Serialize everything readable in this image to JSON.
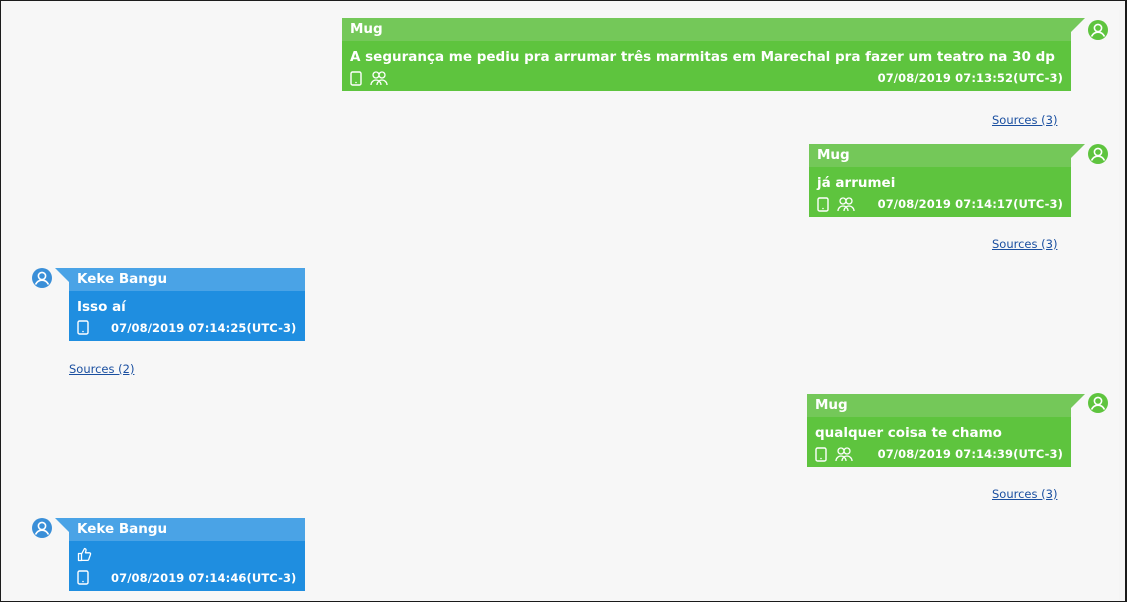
{
  "messages": [
    {
      "sender": "Mug",
      "text": "A segurança me pediu pra arrumar três marmitas em Marechal pra fazer um teatro na 30 dp",
      "timestamp": "07/08/2019 07:13:52(UTC-3)",
      "sources": "Sources (3)",
      "icons": [
        "phone-icon",
        "group-icon"
      ]
    },
    {
      "sender": "Mug",
      "text": "já arrumei",
      "timestamp": "07/08/2019 07:14:17(UTC-3)",
      "sources": "Sources (3)",
      "icons": [
        "phone-icon",
        "group-icon"
      ]
    },
    {
      "sender": "Keke Bangu",
      "text": "Isso aí",
      "timestamp": "07/08/2019 07:14:25(UTC-3)",
      "sources": "Sources (2)",
      "icons": [
        "phone-icon"
      ]
    },
    {
      "sender": "Mug",
      "text": "qualquer coisa te chamo",
      "timestamp": "07/08/2019 07:14:39(UTC-3)",
      "sources": "Sources (3)",
      "icons": [
        "phone-icon",
        "group-icon"
      ]
    },
    {
      "sender": "Keke Bangu",
      "text": "👍",
      "timestamp": "07/08/2019 07:14:46(UTC-3)",
      "icons": [
        "phone-icon"
      ]
    }
  ],
  "colors": {
    "outgoing_header": "#74c859",
    "outgoing_body": "#5ec43e",
    "incoming_header": "#4aa3e6",
    "incoming_body": "#1f8ee0",
    "link": "#1a4fa0"
  }
}
